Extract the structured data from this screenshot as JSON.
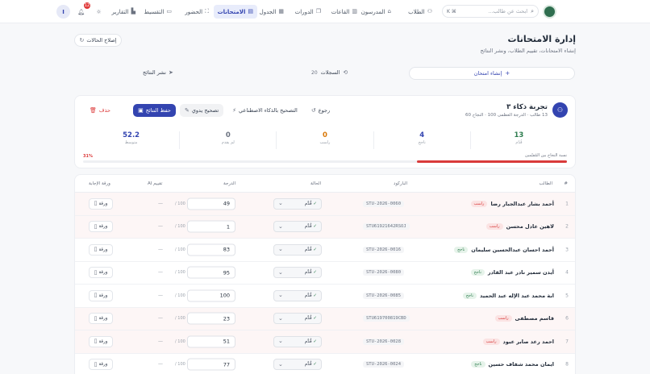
{
  "nav": {
    "search_placeholder": "ابحث عن طالب...",
    "search_shortcut": "⌘ K",
    "items": [
      {
        "label": "الطلاب",
        "icon": "users-icon"
      },
      {
        "label": "المدرسون",
        "icon": "graduation-cap-icon"
      },
      {
        "label": "القاعات",
        "icon": "building-icon"
      },
      {
        "label": "الدورات",
        "icon": "book-icon"
      },
      {
        "label": "الجدول",
        "icon": "calendar-icon"
      },
      {
        "label": "الامتحانات",
        "icon": "clipboard-icon"
      },
      {
        "label": "الحضور",
        "icon": "scan-icon"
      },
      {
        "label": "التقسيط",
        "icon": "wallet-icon"
      },
      {
        "label": "التقارير",
        "icon": "chart-icon"
      }
    ],
    "active": "الامتحانات",
    "notifications": "12",
    "user_initial": "I"
  },
  "header": {
    "title": "إدارة الامتحانات",
    "subtitle": "إنشاء الامتحانات، تقييم الطلاب، ونشر النتائج",
    "fix_button": "إصلاح الحالات"
  },
  "toolbar": {
    "create_label": "إنشاء امتحان",
    "records_label": "السجلات",
    "records_count": "20",
    "publish_label": "نشر النتائج"
  },
  "exam": {
    "title": "تجربة ذكاء ٣",
    "meta": "13 طالب · الدرجة العظمى 100 · النجاح 60",
    "actions": {
      "back": "رجوع",
      "ai_grade": "التصحيح بالذكاء الاصطناعي",
      "manual": "تصحيح يدوي",
      "save": "حفظ النتائج",
      "delete": "حذف"
    },
    "stats": [
      {
        "label": "قُدّم",
        "value": "13",
        "color": "#2e7d4f"
      },
      {
        "label": "ناجح",
        "value": "4",
        "color": "#3344b0"
      },
      {
        "label": "راسب",
        "value": "0",
        "color": "#d97706"
      },
      {
        "label": "لم يقدم",
        "value": "0",
        "color": "#6b7280"
      },
      {
        "label": "متوسط",
        "value": "52.2",
        "color": "#3344b0"
      }
    ],
    "pass_rate_label": "نسبة النجاح بين المُقيّمين",
    "pass_rate_text": "31%",
    "pass_rate": 0.31
  },
  "table": {
    "headers": [
      "#",
      "الطالب",
      "الباركود",
      "الحالة",
      "الدرجة",
      "تقييم AI",
      "ورقة الإجابة"
    ],
    "max_label": "/ 100",
    "ai_placeholder": "—",
    "status_label": "قُدِّم",
    "paper_label": "ورقة",
    "rows": [
      {
        "n": "1",
        "name": "أحمد بشار عبدالجبار رضا",
        "tag": "راسب",
        "pass": false,
        "code": "STU-2026-0060",
        "grade": "49"
      },
      {
        "n": "2",
        "name": "لاهين عادل محسن",
        "tag": "راسب",
        "pass": false,
        "code": "STU61921642RSOJ",
        "grade": "1"
      },
      {
        "n": "3",
        "name": "أحمد احسان عبدالحسين سليمان",
        "tag": "ناجح",
        "pass": true,
        "code": "STU-2026-0016",
        "grade": "83"
      },
      {
        "n": "4",
        "name": "أيدن سمير نادر عبد القادر",
        "tag": "ناجح",
        "pass": true,
        "code": "STU-2026-0080",
        "grade": "95"
      },
      {
        "n": "5",
        "name": "ابة محمد عبد الإله عبد الحميد",
        "tag": "ناجح",
        "pass": true,
        "code": "STU-2026-0085",
        "grade": "100"
      },
      {
        "n": "6",
        "name": "قاسم مصطفى",
        "tag": "راسب",
        "pass": false,
        "code": "STU619700819CBD",
        "grade": "23"
      },
      {
        "n": "7",
        "name": "احمد رعد صابر عبود",
        "tag": "راسب",
        "pass": false,
        "code": "STU-2026-0028",
        "grade": "51"
      },
      {
        "n": "8",
        "name": "ايمان محمد شفاف حسين",
        "tag": "ناجح",
        "pass": true,
        "code": "STU-2026-0024",
        "grade": "77"
      }
    ]
  }
}
